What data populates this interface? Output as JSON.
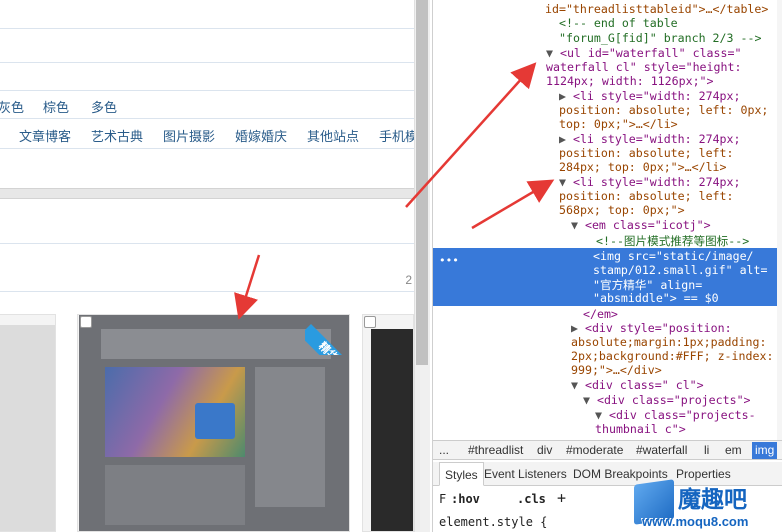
{
  "page": {
    "color_filters": [
      "灰色",
      "棕色",
      "多色"
    ],
    "categories": [
      "文章博客",
      "艺术古典",
      "图片摄影",
      "婚嫁婚庆",
      "其他站点",
      "手机模"
    ],
    "page_number": "2",
    "badge_text": "精华"
  },
  "devtools": {
    "lines": {
      "l1": "id=\"threadlisttableid\">…</table>",
      "l2": "<!-- end of table",
      "l3": "\"forum_G[fid]\" branch 2/3 -->",
      "l4a": "<ul id=\"waterfall\" class=\"",
      "l4b": "waterfall cl\" style=\"height:",
      "l4c": "1124px; width: 1126px;\">",
      "l5a": "<li style=\"width: 274px;",
      "l5b": "position: absolute; left: 0px;",
      "l5c": "top: 0px;\">…</li>",
      "l6a": "<li style=\"width: 274px;",
      "l6b": "position: absolute; left:",
      "l6c": "284px; top: 0px;\">…</li>",
      "l7a": "<li style=\"width: 274px;",
      "l7b": "position: absolute; left:",
      "l7c": "568px; top: 0px;\">",
      "l8": "<em class=\"icotj\">",
      "l9": "<!--图片模式推荐等图标-->",
      "l10a": "<img src=\"static/image/",
      "l10b": "stamp/012.small.gif\" alt=",
      "l10c": "\"官方精华\" align=",
      "l10d": "\"absmiddle\"> == $0",
      "l11": "</em>",
      "l12a": "<div style=\"position:",
      "l12b": "absolute;margin:1px;padding:",
      "l12c": "2px;background:#FFF; z-index:",
      "l12d": "999;\">…</div>",
      "l13": "<div class=\" cl\">",
      "l14": "<div class=\"projects\">",
      "l15a": "<div class=\"projects-",
      "l15b": "thumbnail c\">"
    },
    "selected_dots": "•••",
    "breadcrumbs": [
      "...",
      "#threadlist",
      "div",
      "#moderate",
      "#waterfall",
      "li",
      "em",
      "img"
    ],
    "tabs": [
      "Styles",
      "Event Listeners",
      "DOM Breakpoints",
      "Properties"
    ],
    "filter": {
      "f": "F",
      "hov": ":hov",
      "cls": ".cls",
      "plus": "+"
    },
    "element_style": "element.style {"
  },
  "watermark": {
    "title": "魔趣吧",
    "url": "www.moqu8.com"
  },
  "colors": {
    "selection": "#3879d9",
    "tag": "#881280",
    "attr": "#994500",
    "value": "#1a1aa6",
    "comment": "#236e25",
    "arrow": "#e53935",
    "badge": "#2a9be0"
  }
}
